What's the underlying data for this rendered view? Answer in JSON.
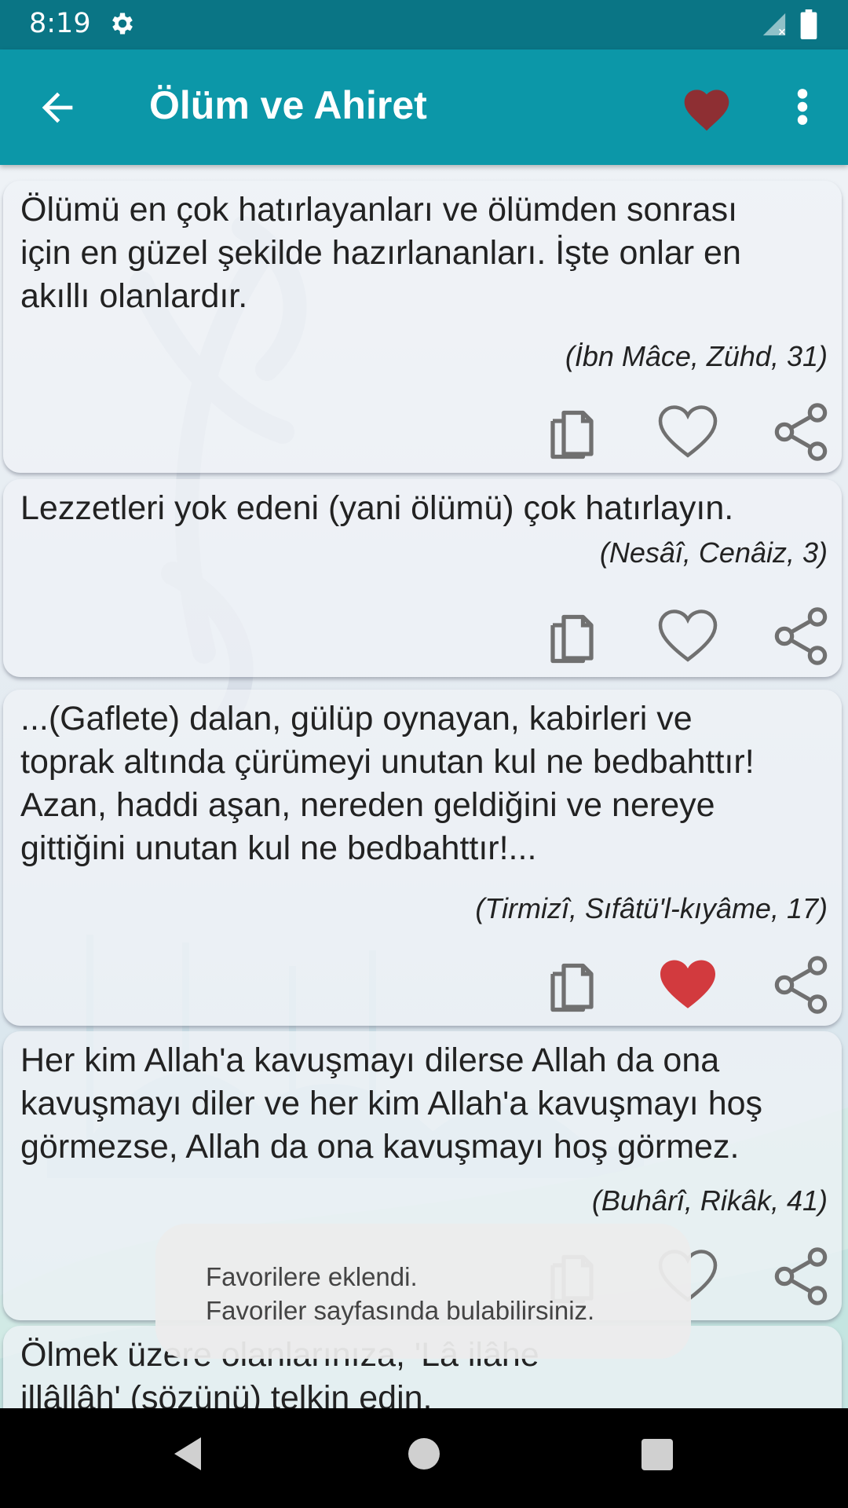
{
  "status_bar": {
    "time": "8:19",
    "icons": [
      "gear-icon",
      "signal-icon",
      "battery-icon"
    ]
  },
  "app_bar": {
    "title": "Ölüm ve Ahiret",
    "back_icon": "arrow-back-icon",
    "favorite_icon": "heart-filled-icon",
    "more_icon": "more-vert-icon"
  },
  "colors": {
    "status_bar": "#0a7585",
    "app_bar": "#0c97a8",
    "heart_header": "#8e2f33",
    "heart_active": "#d23a3e",
    "icon_outline": "#707070"
  },
  "cards": [
    {
      "text": "Ölümü en çok hatırlayanları ve ölümden sonrası\niçin en güzel şekilde hazırlananları. İşte onlar en\nakıllı olanlardır.",
      "source": "(İbn Mâce, Zühd, 31)",
      "favorited": false
    },
    {
      "text": "Lezzetleri yok edeni (yani ölümü) çok hatırlayın.",
      "source": "(Nesâî, Cenâiz, 3)",
      "favorited": false
    },
    {
      "text": "...(Gaflete) dalan, gülüp oynayan, kabirleri ve\ntoprak altında çürümeyi unutan kul ne bedbahttır!\nAzan, haddi aşan, nereden geldiğini ve nereye\ngittiğini unutan kul ne bedbahttır!...",
      "source": "(Tirmizî, Sıfâtü'l-kıyâme, 17)",
      "favorited": true
    },
    {
      "text": "Her kim Allah'a kavuşmayı dilerse Allah da ona\nkavuşmayı diler ve her kim Allah'a kavuşmayı hoş\ngörmezse, Allah da ona kavuşmayı hoş görmez.",
      "source": "(Buhârî, Rikâk, 41)",
      "favorited": false
    },
    {
      "text": "Ölmek üzere olanlarınıza, 'Lâ ilâhe\nillâllâh' (sözünü) telkin edin.",
      "source": "",
      "favorited": false
    }
  ],
  "card_actions": [
    "copy-icon",
    "heart-icon",
    "share-icon"
  ],
  "toast": {
    "line1": "Favorilere eklendi.",
    "line2": "Favoriler sayfasında bulabilirsiniz."
  },
  "nav_bar": {
    "icons": [
      "nav-back-icon",
      "nav-home-icon",
      "nav-recents-icon"
    ]
  }
}
